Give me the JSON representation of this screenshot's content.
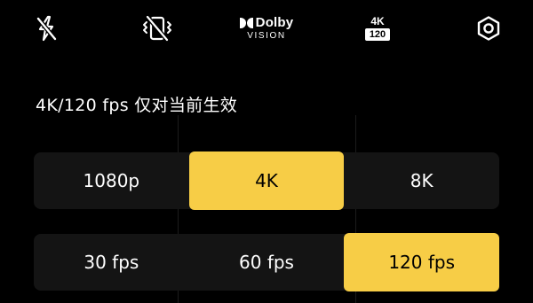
{
  "toolbar": {
    "items": [
      {
        "icon": "flash-off-icon"
      },
      {
        "icon": "stabilization-off-icon"
      },
      {
        "icon": "dolby-vision-icon",
        "brand": "Dolby",
        "sub": "VISION"
      },
      {
        "icon": "video-format-badge-icon",
        "top": "4K",
        "bottom": "120"
      },
      {
        "icon": "settings-icon"
      }
    ]
  },
  "hint": "4K/120 fps 仅对当前生效",
  "resolution": {
    "options": [
      "1080p",
      "4K",
      "8K"
    ],
    "selected": "4K"
  },
  "framerate": {
    "options": [
      "30 fps",
      "60 fps",
      "120 fps"
    ],
    "selected": "120 fps"
  },
  "colors": {
    "accent": "#f7cd46",
    "segment_bg": "#141414",
    "background": "#000000"
  }
}
